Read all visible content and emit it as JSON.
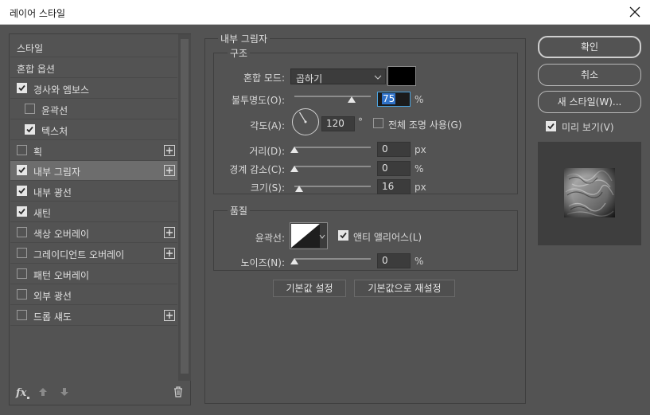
{
  "window": {
    "title": "레이어 스타일",
    "close_icon": "close-icon"
  },
  "style_list": {
    "items": [
      {
        "label": "스타일",
        "checkbox": false,
        "checked": false,
        "plus": false,
        "indent": false,
        "selected": false
      },
      {
        "label": "혼합 옵션",
        "checkbox": false,
        "checked": false,
        "plus": false,
        "indent": false,
        "selected": false
      },
      {
        "label": "경사와 엠보스",
        "checkbox": true,
        "checked": true,
        "plus": false,
        "indent": false,
        "selected": false
      },
      {
        "label": "윤곽선",
        "checkbox": true,
        "checked": false,
        "plus": false,
        "indent": true,
        "selected": false
      },
      {
        "label": "텍스처",
        "checkbox": true,
        "checked": true,
        "plus": false,
        "indent": true,
        "selected": false
      },
      {
        "label": "획",
        "checkbox": true,
        "checked": false,
        "plus": true,
        "indent": false,
        "selected": false
      },
      {
        "label": "내부 그림자",
        "checkbox": true,
        "checked": true,
        "plus": true,
        "indent": false,
        "selected": true
      },
      {
        "label": "내부 광선",
        "checkbox": true,
        "checked": true,
        "plus": false,
        "indent": false,
        "selected": false
      },
      {
        "label": "새틴",
        "checkbox": true,
        "checked": true,
        "plus": false,
        "indent": false,
        "selected": false
      },
      {
        "label": "색상 오버레이",
        "checkbox": true,
        "checked": false,
        "plus": true,
        "indent": false,
        "selected": false
      },
      {
        "label": "그레이디언트 오버레이",
        "checkbox": true,
        "checked": false,
        "plus": true,
        "indent": false,
        "selected": false
      },
      {
        "label": "패턴 오버레이",
        "checkbox": true,
        "checked": false,
        "plus": false,
        "indent": false,
        "selected": false
      },
      {
        "label": "외부 광선",
        "checkbox": true,
        "checked": false,
        "plus": false,
        "indent": false,
        "selected": false
      },
      {
        "label": "드롭 섀도",
        "checkbox": true,
        "checked": false,
        "plus": true,
        "indent": false,
        "selected": false
      }
    ],
    "footer": {
      "fx_label": "fx",
      "icons": [
        "fx-icon",
        "move-up-icon",
        "move-down-icon",
        "trash-icon"
      ]
    }
  },
  "inner_shadow": {
    "title": "내부 그림자",
    "structure": {
      "title": "구조",
      "blend_mode": {
        "label": "혼합 모드:",
        "value": "곱하기"
      },
      "shadow_color": "#000000",
      "opacity": {
        "label": "불투명도(O):",
        "value": "75",
        "unit": "%",
        "level_percent": 75
      },
      "angle": {
        "label": "각도(A):",
        "value": "120",
        "unit": "°",
        "global_light_label": "전체 조명 사용(G)",
        "global_light_checked": false
      },
      "distance": {
        "label": "거리(D):",
        "value": "0",
        "unit": "px",
        "level_percent": 0
      },
      "choke": {
        "label": "경계 감소(C):",
        "value": "0",
        "unit": "%",
        "level_percent": 0
      },
      "size": {
        "label": "크기(S):",
        "value": "16",
        "unit": "px",
        "level_percent": 6
      }
    },
    "quality": {
      "title": "품질",
      "contour": {
        "label": "윤곽선:",
        "anti_alias_label": "앤티 앨리어스(L)",
        "anti_alias_checked": true
      },
      "noise": {
        "label": "노이즈(N):",
        "value": "0",
        "unit": "%",
        "level_percent": 0
      }
    },
    "buttons": {
      "set_default": "기본값 설정",
      "reset_default": "기본값으로 재설정"
    }
  },
  "actions": {
    "ok": "확인",
    "cancel": "취소",
    "new_style": "새 스타일(W)...",
    "preview_label": "미리 보기(V)",
    "preview_checked": true
  },
  "colors": {
    "dialog_bg": "#535353",
    "selected_row": "#6d6d6d",
    "active_field_border": "#4aa3e0",
    "selection_highlight": "#2f72c9"
  }
}
